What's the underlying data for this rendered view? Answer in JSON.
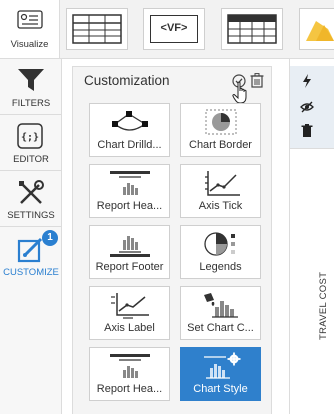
{
  "toolbar": {
    "visualize_label": "Visualize",
    "vf_label": "<VF>"
  },
  "leftnav": {
    "items": [
      {
        "label": "FILTERS"
      },
      {
        "label": "EDITOR"
      },
      {
        "label": "SETTINGS"
      },
      {
        "label": "CUSTOMIZE",
        "badge": "1"
      }
    ]
  },
  "panel": {
    "title": "Customization",
    "cards": [
      {
        "label": "Chart Drilld...",
        "icon": "chart-drilldown-icon"
      },
      {
        "label": "Chart Border",
        "icon": "chart-border-icon"
      },
      {
        "label": "Report Hea...",
        "icon": "report-header-icon"
      },
      {
        "label": "Axis Tick",
        "icon": "axis-tick-icon"
      },
      {
        "label": "Report Footer",
        "icon": "report-footer-icon"
      },
      {
        "label": "Legends",
        "icon": "legends-icon"
      },
      {
        "label": "Axis Label",
        "icon": "axis-label-icon"
      },
      {
        "label": "Set Chart C...",
        "icon": "set-chart-color-icon"
      },
      {
        "label": "Report Hea...",
        "icon": "report-header-icon"
      },
      {
        "label": "Chart Style",
        "icon": "chart-style-icon",
        "selected": true
      }
    ]
  },
  "right": {
    "vertical_text": "TRAVEL COST"
  },
  "colors": {
    "accent": "#2f80cc",
    "badge": "#2a7fd0",
    "yellow": "#f5c542"
  }
}
